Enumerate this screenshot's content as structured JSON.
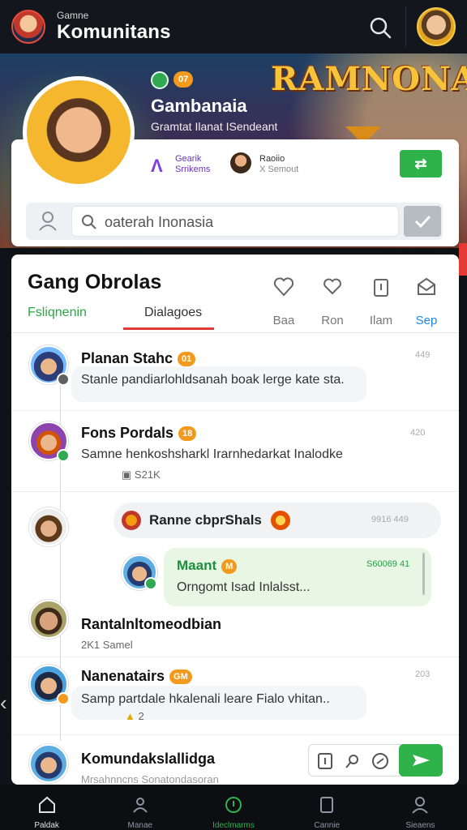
{
  "header": {
    "subtitle": "Gamne",
    "title": "Komunitans"
  },
  "banner": {
    "logo_text": "RAMNONAH"
  },
  "profile": {
    "level_badge": "07",
    "name": "Gambanaia",
    "tagline": "Gramtat Ilanat ISendeant",
    "stat1_line1": "Gearik",
    "stat1_line2": "Srrikems",
    "stat2_line1": "Raoiio",
    "stat2_line2": "X Semout",
    "search_placeholder": "oaterah Inonasia"
  },
  "chat": {
    "title": "Gang Obrolas",
    "tab_friends": "Fsliqnenin",
    "tab_dialogs": "Dialagoes",
    "tools": [
      {
        "label": "Baa"
      },
      {
        "label": "Ron"
      },
      {
        "label": "Ilam"
      },
      {
        "label": "Sep"
      }
    ],
    "messages": [
      {
        "name": "Planan Stahc",
        "badge": "01",
        "time": "449",
        "text": "Stanle pandiarlohldsanah boak lerge kate sta."
      },
      {
        "name": "Fons Pordals",
        "badge": "18",
        "time": "420",
        "text": "Samne henkoshsharkl Irarnhedarkat Inalodke",
        "attachment": "S21K"
      },
      {
        "name": "Ranne cbprShals",
        "time": "9916   449"
      },
      {
        "name": "Maant",
        "badge": "M",
        "time": "S60069 41",
        "text": "Orngomt Isad Inlalsst..."
      },
      {
        "name": "Rantalnltomeodbian",
        "sub": "2K1  Samel"
      },
      {
        "name": "Nanenatairs",
        "badge": "GM",
        "time": "203",
        "text": "Samp partdale hkalenali leare Fialo vhitan..",
        "sub": "2"
      },
      {
        "name": "Komundakslallidga",
        "sub": "Mrsahnncns Sonatondasoran"
      }
    ]
  },
  "bottom_nav": [
    {
      "label": "Paldak"
    },
    {
      "label": "Manae"
    },
    {
      "label": "Ideclmarms"
    },
    {
      "label": "Cannie"
    },
    {
      "label": "Sieaens"
    }
  ]
}
